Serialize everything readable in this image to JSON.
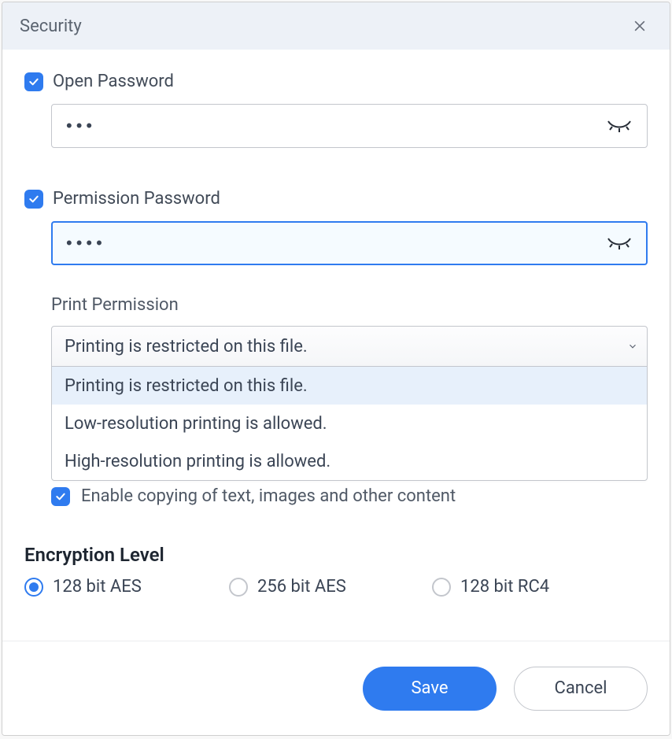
{
  "title": "Security",
  "open_password": {
    "checkbox_label": "Open Password",
    "value": "•••"
  },
  "permission_password": {
    "checkbox_label": "Permission Password",
    "value": "••••"
  },
  "print_permission": {
    "label": "Print Permission",
    "selected": "Printing is restricted on this file.",
    "options": [
      "Printing is restricted on this file.",
      "Low-resolution printing is allowed.",
      "High-resolution printing is allowed."
    ]
  },
  "enable_copy": {
    "label": "Enable copying of text, images and other content"
  },
  "encryption": {
    "title": "Encryption Level",
    "selected": "128 bit AES",
    "options": [
      "128 bit AES",
      "256 bit AES",
      "128 bit RC4"
    ]
  },
  "footer": {
    "save": "Save",
    "cancel": "Cancel"
  }
}
